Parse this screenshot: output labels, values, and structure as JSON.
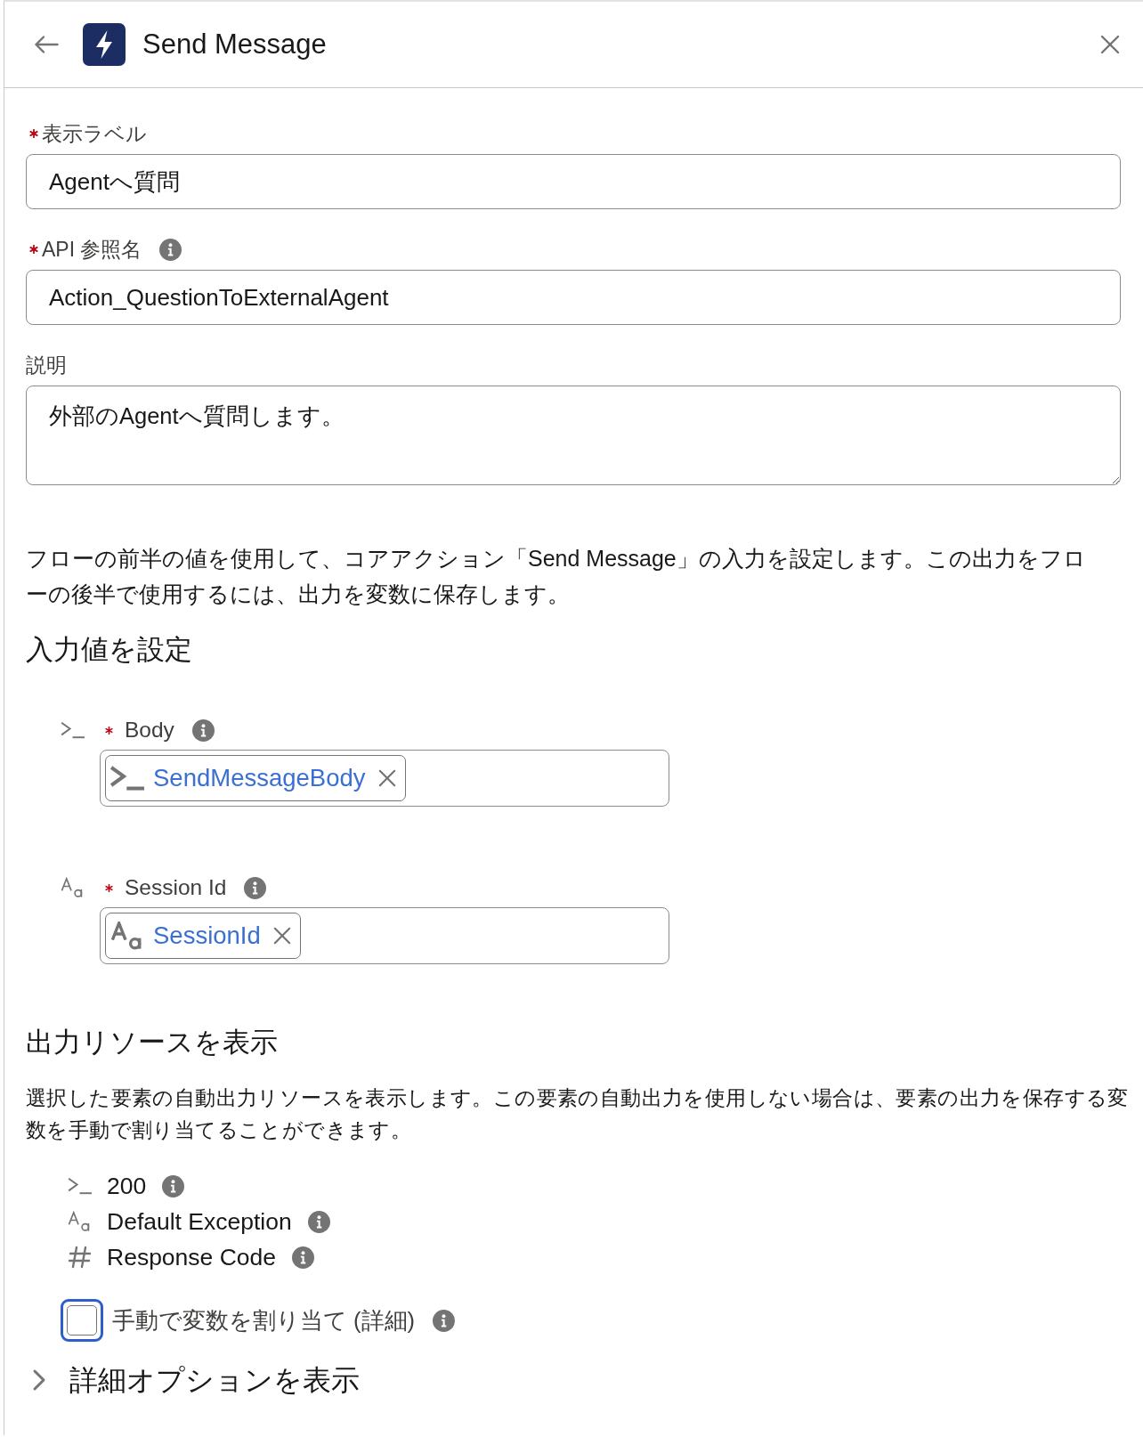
{
  "header": {
    "title": "Send Message"
  },
  "fields": [
    {
      "kind": "input",
      "label": "表示ラベル",
      "required": true,
      "info": false,
      "value": "Agentへ質問"
    },
    {
      "kind": "input",
      "label": "API 参照名",
      "required": true,
      "info": true,
      "value": "Action_QuestionToExternalAgent"
    },
    {
      "kind": "textarea",
      "label": "説明",
      "required": false,
      "info": false,
      "value": "外部のAgentへ質問します。"
    }
  ],
  "intro": "フローの前半の値を使用して、コアアクション「Send Message」の入力を設定します。この出力をフローの後半で使用するには、出力を変数に保存します。",
  "inputs": {
    "heading": "入力値を設定",
    "items": [
      {
        "kind": "template",
        "label": "Body",
        "required": true,
        "info": true,
        "value": "SendMessageBody"
      },
      {
        "kind": "text",
        "label": "Session Id",
        "required": true,
        "info": true,
        "value": "SessionId"
      }
    ]
  },
  "outputs": {
    "heading": "出力リソースを表示",
    "description": "選択した要素の自動出力リソースを表示します。この要素の自動出力を使用しない場合は、要素の出力を保存する変数を手動で割り当てることができます。",
    "items": [
      {
        "kind": "template",
        "label": "200",
        "info": true
      },
      {
        "kind": "text",
        "label": "Default Exception",
        "info": true
      },
      {
        "kind": "number",
        "label": "Response Code",
        "info": true
      }
    ],
    "manual_assign": {
      "label": "手動で変数を割り当て (詳細)",
      "checked": false,
      "focused": true,
      "info": true
    }
  },
  "advanced": {
    "label": "詳細オプションを表示",
    "expanded": false
  }
}
